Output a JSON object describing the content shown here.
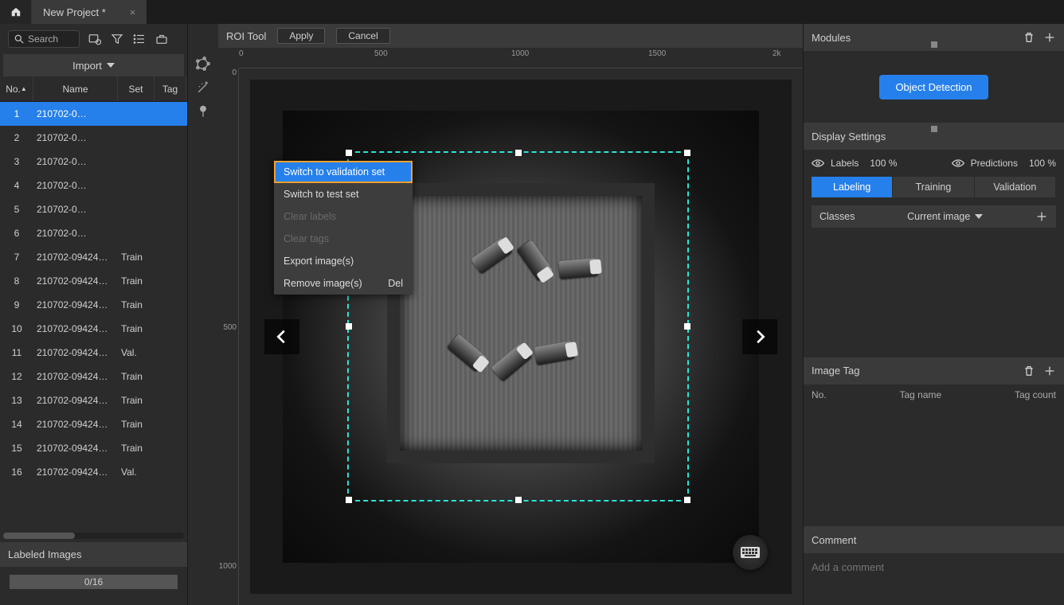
{
  "titlebar": {
    "tab": "New Project *"
  },
  "sidebar": {
    "search_placeholder": "Search",
    "import": "Import",
    "columns": {
      "no": "No.",
      "name": "Name",
      "set": "Set",
      "tag": "Tag"
    },
    "rows": [
      {
        "no": "1",
        "name": "210702-0…",
        "set": ""
      },
      {
        "no": "2",
        "name": "210702-0…",
        "set": ""
      },
      {
        "no": "3",
        "name": "210702-0…",
        "set": ""
      },
      {
        "no": "4",
        "name": "210702-0…",
        "set": ""
      },
      {
        "no": "5",
        "name": "210702-0…",
        "set": ""
      },
      {
        "no": "6",
        "name": "210702-0…",
        "set": ""
      },
      {
        "no": "7",
        "name": "210702-09424…",
        "set": "Train"
      },
      {
        "no": "8",
        "name": "210702-09424…",
        "set": "Train"
      },
      {
        "no": "9",
        "name": "210702-09424…",
        "set": "Train"
      },
      {
        "no": "10",
        "name": "210702-09424…",
        "set": "Train"
      },
      {
        "no": "11",
        "name": "210702-09424…",
        "set": "Val."
      },
      {
        "no": "12",
        "name": "210702-09424…",
        "set": "Train"
      },
      {
        "no": "13",
        "name": "210702-09424…",
        "set": "Train"
      },
      {
        "no": "14",
        "name": "210702-09424…",
        "set": "Train"
      },
      {
        "no": "15",
        "name": "210702-09424…",
        "set": "Train"
      },
      {
        "no": "16",
        "name": "210702-09424…",
        "set": "Val."
      }
    ],
    "labeled_header": "Labeled Images",
    "progress": "0/16"
  },
  "center": {
    "roi_tool": "ROI Tool",
    "apply": "Apply",
    "cancel": "Cancel",
    "ruler_h": [
      "0",
      "500",
      "1000",
      "1500",
      "2k"
    ],
    "ruler_v": [
      "0",
      "500",
      "1000"
    ]
  },
  "context_menu": {
    "items": [
      {
        "label": "Switch to validation set",
        "state": "highlight"
      },
      {
        "label": "Switch to test set",
        "state": "normal"
      },
      {
        "label": "Clear labels",
        "state": "disabled"
      },
      {
        "label": "Clear tags",
        "state": "disabled"
      },
      {
        "label": "Export image(s)",
        "state": "normal"
      },
      {
        "label": "Remove image(s)",
        "state": "normal",
        "shortcut": "Del"
      }
    ]
  },
  "right": {
    "modules": {
      "title": "Modules",
      "node": "Object Detection"
    },
    "display": {
      "title": "Display Settings",
      "labels": "Labels",
      "labels_pct": "100 %",
      "predictions": "Predictions",
      "predictions_pct": "100 %",
      "tabs": [
        "Labeling",
        "Training",
        "Validation"
      ],
      "classes": "Classes",
      "classes_scope": "Current image"
    },
    "image_tag": {
      "title": "Image Tag",
      "cols": [
        "No.",
        "Tag name",
        "Tag count"
      ]
    },
    "comment": {
      "title": "Comment",
      "placeholder": "Add a comment"
    }
  }
}
